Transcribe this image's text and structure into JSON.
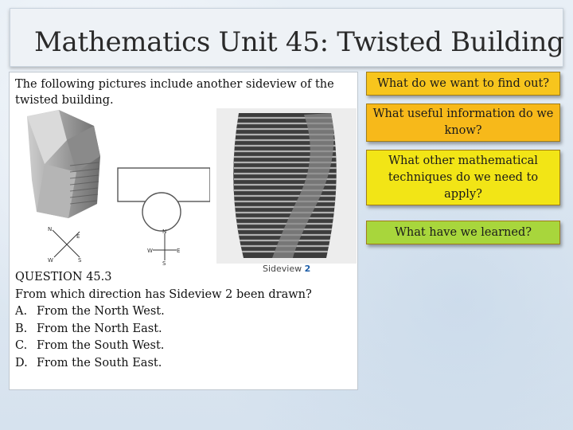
{
  "title": "Mathematics Unit 45: Twisted Building",
  "intro": "The following pictures include another sideview of the twisted building.",
  "figure": {
    "sideview_caption": "Sideview",
    "sideview_number": "2",
    "compass1": {
      "n": "N",
      "e": "E",
      "s": "S",
      "w": "W"
    },
    "compass2": {
      "n": "N",
      "e": "E",
      "s": "S",
      "w": "W"
    }
  },
  "question": {
    "heading": "QUESTION 45.3",
    "text": "From which direction has Sideview 2 been drawn?",
    "options": [
      {
        "letter": "A.",
        "text": "From the North West."
      },
      {
        "letter": "B.",
        "text": "From the North East."
      },
      {
        "letter": "C.",
        "text": "From the South West."
      },
      {
        "letter": "D.",
        "text": "From the South East."
      }
    ]
  },
  "callouts": [
    {
      "text": "What do we want to find out?",
      "color": "#f7c51d"
    },
    {
      "text": "What useful information do we know?",
      "color": "#f7b91a"
    },
    {
      "text": "What other mathematical techniques do we need to apply?",
      "color": "#f2e516"
    },
    {
      "text": "What have we learned?",
      "color": "#a8d63c"
    }
  ]
}
